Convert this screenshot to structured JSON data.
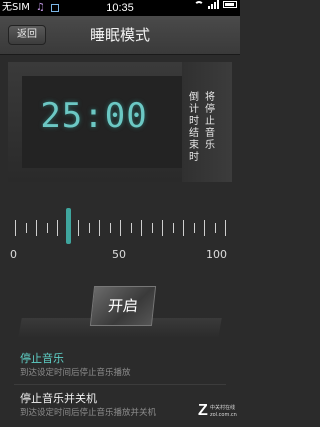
{
  "status_bar": {
    "carrier": "无SIM",
    "time": "10:35"
  },
  "header": {
    "back_label": "返回",
    "title": "睡眠模式"
  },
  "timer": {
    "display": "25:00",
    "caption_col1": "倒计时结束时",
    "caption_col2": "将停止音乐"
  },
  "slider": {
    "min_label": "0",
    "mid_label": "50",
    "max_label": "100",
    "value": 25
  },
  "start_button": {
    "label": "开启"
  },
  "options": [
    {
      "title": "停止音乐",
      "desc": "到达设定时间后停止音乐播放",
      "selected": true
    },
    {
      "title": "停止音乐并关机",
      "desc": "到达设定时间后停止音乐播放并关机"
    }
  ],
  "watermark": {
    "cn": "中关村在线",
    "url": "zol.com.cn"
  },
  "colors": {
    "accent": "#5fd0c7",
    "timer": "#6cc8c4",
    "thumb": "#3fa59d"
  }
}
